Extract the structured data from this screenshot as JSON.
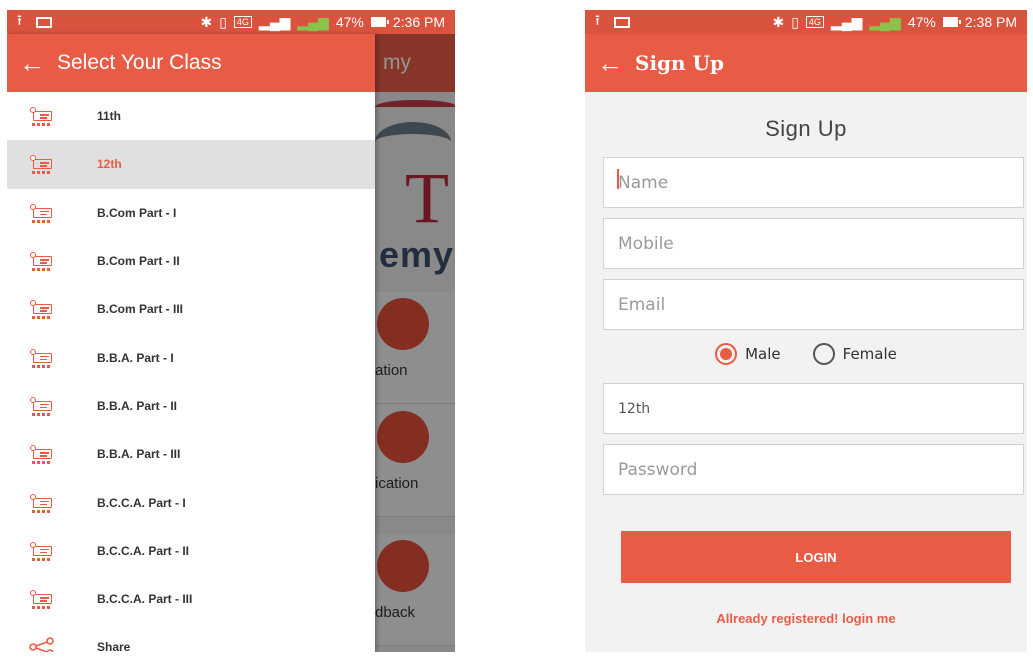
{
  "left_phone": {
    "status_bar": {
      "battery": "47%",
      "time": "2:36 PM",
      "network": "4G"
    },
    "drawer": {
      "title": "Select Your Class",
      "items": [
        {
          "label": "11th",
          "icon": "classroom-icon",
          "active": false
        },
        {
          "label": "12th",
          "icon": "classroom-icon",
          "active": true
        },
        {
          "label": "B.Com Part - I",
          "icon": "classroom-icon",
          "active": false
        },
        {
          "label": "B.Com Part - II",
          "icon": "classroom-icon",
          "active": false
        },
        {
          "label": "B.Com Part - III",
          "icon": "classroom-icon",
          "active": false
        },
        {
          "label": "B.B.A. Part - I",
          "icon": "classroom-icon",
          "active": false
        },
        {
          "label": "B.B.A. Part - II",
          "icon": "classroom-icon",
          "active": false
        },
        {
          "label": "B.B.A. Part - III",
          "icon": "classroom-icon",
          "active": false
        },
        {
          "label": "B.C.C.A. Part - I",
          "icon": "classroom-icon",
          "active": false
        },
        {
          "label": "B.C.C.A. Part - II",
          "icon": "classroom-icon",
          "active": false
        },
        {
          "label": "B.C.C.A. Part - III",
          "icon": "classroom-icon",
          "active": false
        },
        {
          "label": "Share",
          "icon": "share-icon",
          "active": false
        }
      ]
    },
    "background_app": {
      "title_fragment": "my",
      "logo_letter": "T",
      "logo_word_fragment": "emy",
      "cards": [
        {
          "label": "ation"
        },
        {
          "label": "ication"
        },
        {
          "label": "dback"
        }
      ]
    }
  },
  "right_phone": {
    "status_bar": {
      "battery": "47%",
      "time": "2:38 PM",
      "network": "4G"
    },
    "app_bar_title": "Sign Up",
    "heading": "Sign Up",
    "fields": {
      "name_placeholder": "Name",
      "mobile_placeholder": "Mobile",
      "email_placeholder": "Email",
      "class_value": "12th",
      "password_placeholder": "Password"
    },
    "gender": {
      "male_label": "Male",
      "female_label": "Female",
      "selected": "Male"
    },
    "login_button": "LOGIN",
    "login_link": "Allready registered! login me"
  },
  "colors": {
    "primary": "#e85c45",
    "status_bar": "#d9533f",
    "active_row": "#e0e0e0",
    "form_bg": "#f2f2f2"
  }
}
